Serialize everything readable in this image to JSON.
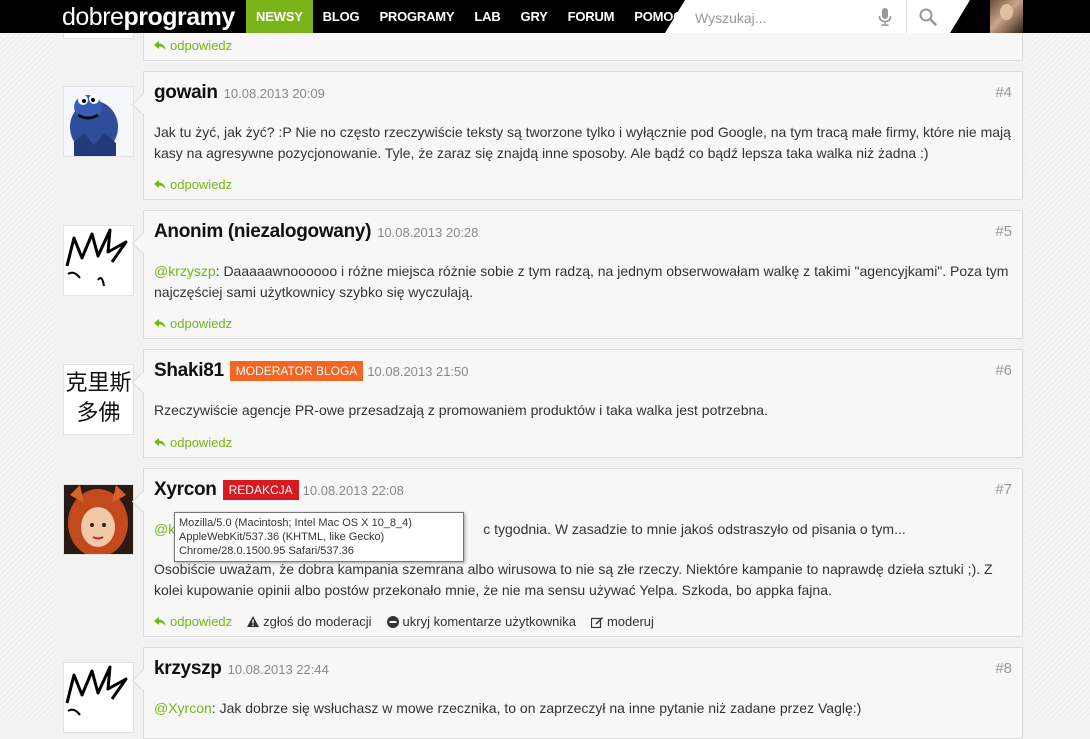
{
  "topbar": {
    "logo_light": "dobre",
    "logo_bold": "programy",
    "nav": [
      {
        "label": "NEWSY",
        "active": true
      },
      {
        "label": "BLOG",
        "active": false
      },
      {
        "label": "PROGRAMY",
        "active": false
      },
      {
        "label": "LAB",
        "active": false
      },
      {
        "label": "GRY",
        "active": false
      },
      {
        "label": "FORUM",
        "active": false
      },
      {
        "label": "POMOC",
        "active": false
      }
    ],
    "search_placeholder": "Wyszukaj..."
  },
  "reply_label": "odpowiedz",
  "comments": [
    {
      "author": "gowain",
      "date": "10.08.2013 20:09",
      "number": "#4",
      "text": "Jak tu żyć, jak żyć? :P Nie no często rzeczywiście teksty są tworzone tylko i wyłącznie pod Google, na tym tracą małe firmy, które nie mają kasy na agresywne pozycjonowanie. Tyle, że zaraz się znajdą inne sposoby. Ale bądź co bądź lepsza taka walka niż żadna :)"
    },
    {
      "author": "Anonim (niezalogowany)",
      "date": "10.08.2013 20:28",
      "number": "#5",
      "mention": "@krzyszp",
      "text": ": Daaaaawnoooooo i różne miejsca różnie sobie z tym radzą, na jednym obserwowałam walkę z takimi \"agencyjkami\". Poza tym najczęściej sami użytkownicy szybko się wyczulają."
    },
    {
      "author": "Shaki81",
      "badge": "MODERATOR BLOGA",
      "date": "10.08.2013 21:50",
      "number": "#6",
      "text": "Rzeczywiście agencje PR-owe przesadzają z promowaniem produktów i taka walka jest potrzebna.",
      "avatar_text": [
        "克里斯",
        "多佛"
      ]
    },
    {
      "author": "Xyrcon",
      "badge": "REDAKCJA",
      "date": "10.08.2013 22:08",
      "number": "#7",
      "mention": "@k",
      "text_line1_tail": "c tygodnia. W zasadzie to mnie jakoś odstraszyło od pisania o tym...",
      "text2": "Osobiście uważam, że dobra kampania szemrana albo wirusowa to nie są złe rzeczy. Niektóre kampanie to naprawdę dzieła sztuki ;). Z kolei kupowanie opinii albo postów przekonało mnie, że nie ma sensu używać Yelpa. Szkoda, bo appka fajna.",
      "actions": [
        "zgłoś do moderacji",
        "ukryj komentarze użytkownika",
        "moderuj"
      ]
    },
    {
      "author": "krzyszp",
      "date": "10.08.2013 22:44",
      "number": "#8",
      "mention": "@Xyrcon",
      "text": ": Jak dobrze się wsłuchasz w mowe rzecznika, to on zaprzeczył na inne pytanie niż zadane przez Vaglę:)"
    }
  ],
  "tooltip": "Mozilla/5.0 (Macintosh; Intel Mac OS X 10_8_4) AppleWebKit/537.36 (KHTML, like Gecko) Chrome/28.0.1500.95 Safari/537.36",
  "colors": {
    "accent": "#7ab317",
    "moderator_badge": "#f26522",
    "redakcja_badge": "#d71920"
  }
}
